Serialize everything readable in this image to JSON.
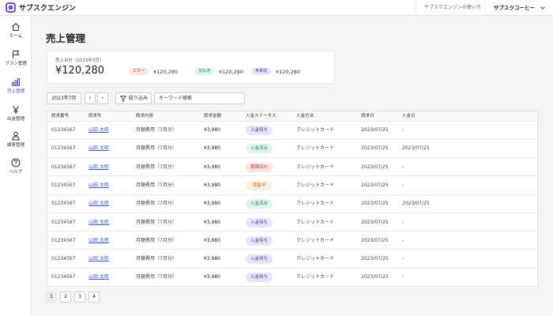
{
  "app": {
    "logo_text": "サブスクエンジン",
    "accent": "#6c4ad8"
  },
  "topbar": {
    "help_link": "サブスクエンジンの使い方",
    "user_name": "サブスクコーヒー"
  },
  "sidebar": {
    "items": [
      {
        "label": "ホーム",
        "icon": "home-icon"
      },
      {
        "label": "プラン管理",
        "icon": "flag-icon"
      },
      {
        "label": "売上管理",
        "icon": "bar-chart-icon",
        "active": true
      },
      {
        "label": "出金管理",
        "icon": "yen-icon"
      },
      {
        "label": "顧客管理",
        "icon": "person-icon"
      },
      {
        "label": "ヘルプ",
        "icon": "help-icon"
      }
    ]
  },
  "page": {
    "title": "売上管理"
  },
  "summary": {
    "label": "売上合計（2023年7月）",
    "total": "¥120,280",
    "items": [
      {
        "badge": "エラー",
        "amount": "¥120,280",
        "color": "#c0392b"
      },
      {
        "badge": "支払済",
        "amount": "¥120,280",
        "color": "#1e8a55"
      },
      {
        "badge": "未承認",
        "amount": "¥120,280",
        "color": "#4a3a9a"
      }
    ]
  },
  "filters": {
    "month": "2023年7月",
    "prev": "‹",
    "next": "›",
    "filter_label": "絞り込み",
    "keyword_placeholder": "キーワード検索"
  },
  "table": {
    "columns": [
      "請求番号",
      "請求先",
      "請求内容",
      "請求金額",
      "入金ステータス",
      "入金方法",
      "請求日",
      "入金日"
    ],
    "rows": [
      {
        "id": "01234567",
        "customer": "山田 太郎",
        "content": "月額費用（7月分）",
        "amount": "¥3,980",
        "status": "入金待ち",
        "status_type": "wait",
        "method": "クレジットカード",
        "billed": "2023/07/25",
        "paid": "-"
      },
      {
        "id": "01234567",
        "customer": "山田 太郎",
        "content": "月額費用（7月分）",
        "amount": "¥3,980",
        "status": "入金済み",
        "status_type": "paid",
        "method": "クレジットカード",
        "billed": "2023/07/25",
        "paid": "2023/07/25"
      },
      {
        "id": "01234567",
        "customer": "山田 太郎",
        "content": "月額費用（7月分）",
        "amount": "¥3,980",
        "status": "期限切れ",
        "status_type": "expired",
        "method": "クレジットカード",
        "billed": "2023/07/25",
        "paid": "-"
      },
      {
        "id": "01234567",
        "customer": "山田 太郎",
        "content": "月額費用（7月分）",
        "amount": "¥3,980",
        "status": "保留中",
        "status_type": "hold",
        "method": "クレジットカード",
        "billed": "2023/07/25",
        "paid": "-"
      },
      {
        "id": "01234567",
        "customer": "山田 太郎",
        "content": "月額費用（7月分）",
        "amount": "¥3,980",
        "status": "入金済み",
        "status_type": "paid",
        "method": "クレジットカード",
        "billed": "2023/07/25",
        "paid": "2023/07/25"
      },
      {
        "id": "01234567",
        "customer": "山田 太郎",
        "content": "月額費用（7月分）",
        "amount": "¥3,980",
        "status": "入金待ち",
        "status_type": "wait",
        "method": "クレジットカード",
        "billed": "2023/07/25",
        "paid": "-"
      },
      {
        "id": "01234567",
        "customer": "山田 太郎",
        "content": "月額費用（7月分）",
        "amount": "¥3,980",
        "status": "入金待ち",
        "status_type": "wait",
        "method": "クレジットカード",
        "billed": "2023/07/25",
        "paid": "-"
      },
      {
        "id": "01234567",
        "customer": "山田 太郎",
        "content": "月額費用（7月分）",
        "amount": "¥3,980",
        "status": "入金待ち",
        "status_type": "wait",
        "method": "クレジットカード",
        "billed": "2023/07/25",
        "paid": "-"
      },
      {
        "id": "01234567",
        "customer": "山田 太郎",
        "content": "月額費用（7月分）",
        "amount": "¥3,980",
        "status": "入金待ち",
        "status_type": "wait",
        "method": "クレジットカード",
        "billed": "2023/07/25",
        "paid": "-"
      }
    ]
  },
  "pagination": {
    "pages": [
      "1",
      "2",
      "3",
      "4"
    ],
    "current": "1"
  }
}
